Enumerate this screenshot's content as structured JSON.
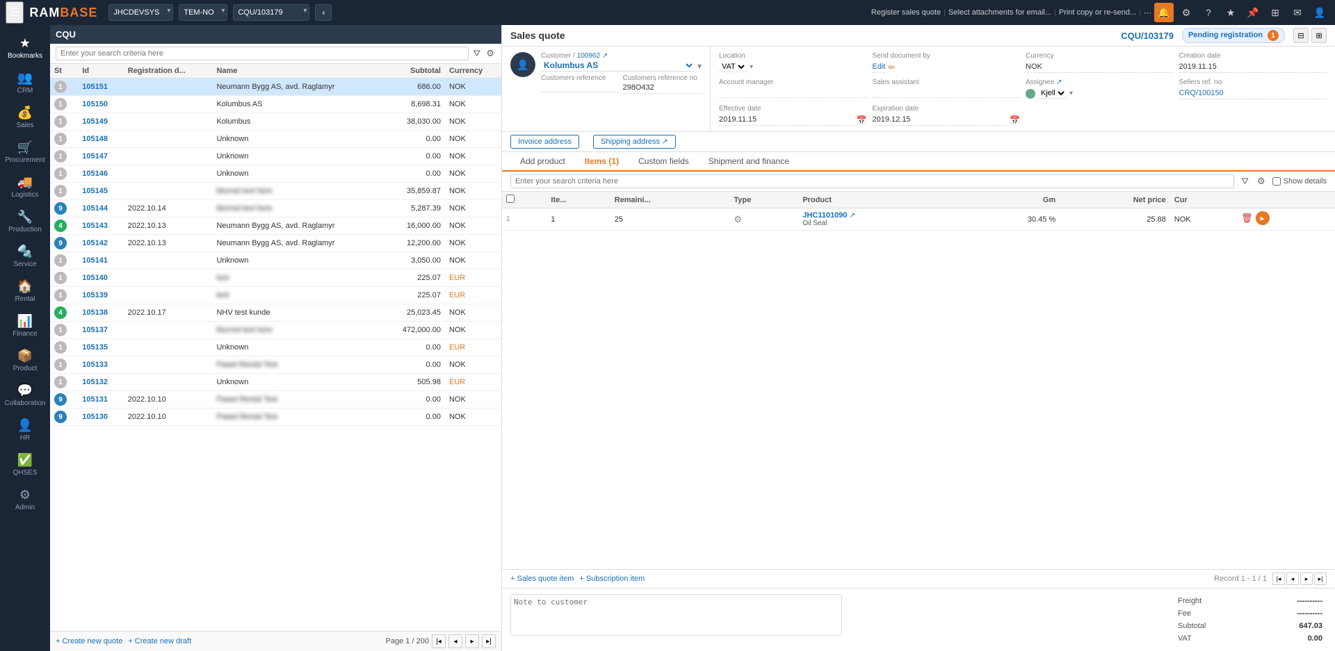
{
  "app": {
    "title": "RAMBASE",
    "module": "CQU"
  },
  "topbar": {
    "menu_icon": "☰",
    "logo": "RAMBASE",
    "dropdowns": [
      "JHCDEVSYS",
      "TEM-NO",
      "CQU/103179"
    ],
    "nav_back": "‹",
    "alert_icon": "🔔",
    "settings_icon": "⚙",
    "help_icon": "?",
    "star_icon": "★",
    "pin_icon": "📌",
    "menu_icon2": "☰",
    "email_icon": "✉",
    "user_icon": "👤",
    "actions": [
      "Register sales quote",
      "Select attachments for email...",
      "Print copy or re-send..."
    ],
    "more_icon": "⋯"
  },
  "sidebar": {
    "items": [
      {
        "id": "bookmarks",
        "label": "Bookmarks",
        "icon": "★"
      },
      {
        "id": "crm",
        "label": "CRM",
        "icon": "👥"
      },
      {
        "id": "sales",
        "label": "Sales",
        "icon": "💰"
      },
      {
        "id": "procurement",
        "label": "Procurement",
        "icon": "🛒"
      },
      {
        "id": "logistics",
        "label": "Logistics",
        "icon": "🚚"
      },
      {
        "id": "production",
        "label": "Production",
        "icon": "🔧"
      },
      {
        "id": "service",
        "label": "Service",
        "icon": "🔩"
      },
      {
        "id": "rental",
        "label": "Rental",
        "icon": "🏠"
      },
      {
        "id": "finance",
        "label": "Finance",
        "icon": "📊"
      },
      {
        "id": "product",
        "label": "Product",
        "icon": "📦"
      },
      {
        "id": "collaboration",
        "label": "Collaboration",
        "icon": "💬"
      },
      {
        "id": "hr",
        "label": "HR",
        "icon": "👤"
      },
      {
        "id": "qhses",
        "label": "QHSES",
        "icon": "✅"
      },
      {
        "id": "admin",
        "label": "Admin",
        "icon": "⚙"
      }
    ]
  },
  "left_panel": {
    "header": "CQU",
    "search_placeholder": "Enter your search criteria here",
    "columns": [
      "St",
      "Id",
      "Registration d...",
      "Name",
      "Subtotal",
      "Currency"
    ],
    "rows": [
      {
        "st": "1",
        "st_class": "status-1",
        "id": "105151",
        "reg_date": "",
        "name": "Neumann Bygg AS, avd. Raglamyr",
        "subtotal": "686.00",
        "currency": "NOK",
        "selected": true,
        "name_blurred": false
      },
      {
        "st": "1",
        "st_class": "status-1",
        "id": "105150",
        "reg_date": "",
        "name": "Kolumbus AS",
        "subtotal": "8,698.31",
        "currency": "NOK",
        "selected": false,
        "name_blurred": false
      },
      {
        "st": "1",
        "st_class": "status-1",
        "id": "105149",
        "reg_date": "",
        "name": "Kolumbus",
        "subtotal": "38,030.00",
        "currency": "NOK",
        "selected": false,
        "name_blurred": false
      },
      {
        "st": "1",
        "st_class": "status-1",
        "id": "105148",
        "reg_date": "",
        "name": "Unknown",
        "subtotal": "0.00",
        "currency": "NOK",
        "selected": false,
        "name_blurred": false
      },
      {
        "st": "1",
        "st_class": "status-1",
        "id": "105147",
        "reg_date": "",
        "name": "Unknown",
        "subtotal": "0.00",
        "currency": "NOK",
        "selected": false,
        "name_blurred": false
      },
      {
        "st": "1",
        "st_class": "status-1",
        "id": "105146",
        "reg_date": "",
        "name": "Unknown",
        "subtotal": "0.00",
        "currency": "NOK",
        "selected": false,
        "name_blurred": false
      },
      {
        "st": "1",
        "st_class": "status-1",
        "id": "105145",
        "reg_date": "",
        "name": "",
        "subtotal": "35,859.87",
        "currency": "NOK",
        "selected": false,
        "name_blurred": true
      },
      {
        "st": "9",
        "st_class": "status-9",
        "id": "105144",
        "reg_date": "2022.10.14",
        "name": "",
        "subtotal": "5,287.39",
        "currency": "NOK",
        "selected": false,
        "name_blurred": true
      },
      {
        "st": "4",
        "st_class": "status-4",
        "id": "105143",
        "reg_date": "2022.10.13",
        "name": "Neumann Bygg AS, avd. Raglamyr",
        "subtotal": "16,000.00",
        "currency": "NOK",
        "selected": false,
        "name_blurred": false
      },
      {
        "st": "9",
        "st_class": "status-9",
        "id": "105142",
        "reg_date": "2022.10.13",
        "name": "Neumann Bygg AS, avd. Raglamyr",
        "subtotal": "12,200.00",
        "currency": "NOK",
        "selected": false,
        "name_blurred": false
      },
      {
        "st": "1",
        "st_class": "status-1",
        "id": "105141",
        "reg_date": "",
        "name": "Unknown",
        "subtotal": "3,050.00",
        "currency": "NOK",
        "selected": false,
        "name_blurred": false
      },
      {
        "st": "1",
        "st_class": "status-1",
        "id": "105140",
        "reg_date": "",
        "name": "test",
        "subtotal": "225.07",
        "currency": "EUR",
        "selected": false,
        "name_blurred": true
      },
      {
        "st": "1",
        "st_class": "status-1",
        "id": "105139",
        "reg_date": "",
        "name": "test",
        "subtotal": "225.07",
        "currency": "EUR",
        "selected": false,
        "name_blurred": true
      },
      {
        "st": "4",
        "st_class": "status-4",
        "id": "105138",
        "reg_date": "2022.10.17",
        "name": "NHV test kunde",
        "subtotal": "25,023.45",
        "currency": "NOK",
        "selected": false,
        "name_blurred": false
      },
      {
        "st": "1",
        "st_class": "status-1",
        "id": "105137",
        "reg_date": "",
        "name": "",
        "subtotal": "472,000.00",
        "currency": "NOK",
        "selected": false,
        "name_blurred": true
      },
      {
        "st": "1",
        "st_class": "status-1",
        "id": "105135",
        "reg_date": "",
        "name": "Unknown",
        "subtotal": "0.00",
        "currency": "EUR",
        "selected": false,
        "name_blurred": false
      },
      {
        "st": "1",
        "st_class": "status-1",
        "id": "105133",
        "reg_date": "",
        "name": "Pawel Rental Test",
        "subtotal": "0.00",
        "currency": "NOK",
        "selected": false,
        "name_blurred": true
      },
      {
        "st": "1",
        "st_class": "status-1",
        "id": "105132",
        "reg_date": "",
        "name": "Unknown",
        "subtotal": "505.98",
        "currency": "EUR",
        "selected": false,
        "name_blurred": false
      },
      {
        "st": "9",
        "st_class": "status-9",
        "id": "105131",
        "reg_date": "2022.10.10",
        "name": "Pawel Rental Test",
        "subtotal": "0.00",
        "currency": "NOK",
        "selected": false,
        "name_blurred": true
      },
      {
        "st": "9",
        "st_class": "status-9",
        "id": "105130",
        "reg_date": "2022.10.10",
        "name": "Pawel Rental Test",
        "subtotal": "0.00",
        "currency": "NOK",
        "selected": false,
        "name_blurred": true
      }
    ],
    "footer": {
      "create_new_quote": "+ Create new quote",
      "create_new_draft": "+ Create new draft",
      "page_info": "Page 1 / 200"
    }
  },
  "right_panel": {
    "title": "Sales quote",
    "doc_id": "CQU/103179",
    "status": "Pending registration",
    "status_count": "1",
    "top_actions": [
      "Register sales quote",
      "Select attachments for email...",
      "Print copy or re-send..."
    ],
    "customer": {
      "number": "100962",
      "name": "Kolumbus AS",
      "ref_label": "Customers reference",
      "ref_value": "",
      "ref_no_label": "Customers reference no",
      "ref_no_value": "298O432"
    },
    "fields": {
      "location_label": "Location",
      "location_value": "VAT",
      "send_doc_label": "Send document by",
      "send_doc_action": "Edit",
      "currency_label": "Currency",
      "currency_value": "NOK",
      "creation_date_label": "Creation date",
      "creation_date_value": "2019.11.15",
      "account_manager_label": "Account manager",
      "account_manager_value": "",
      "sales_assistant_label": "Sales assistant",
      "sales_assistant_value": "",
      "assignee_label": "Assignee",
      "assignee_value": "Kjell",
      "sellers_ref_label": "Sellers ref. no",
      "sellers_ref_value": "CRQ/100150",
      "effective_date_label": "Effective date",
      "effective_date_value": "2019.11.15",
      "expiration_date_label": "Expiration date",
      "expiration_date_value": "2019.12.15"
    },
    "address": {
      "invoice_label": "Invoice address",
      "shipping_label": "Shipping address"
    },
    "tabs": [
      {
        "id": "add-product",
        "label": "Add product"
      },
      {
        "id": "items",
        "label": "Items (1)",
        "active": true
      },
      {
        "id": "custom-fields",
        "label": "Custom fields"
      },
      {
        "id": "shipment-finance",
        "label": "Shipment and finance"
      }
    ],
    "items_toolbar": {
      "search_placeholder": "Enter your search criteria here",
      "show_details": "Show details"
    },
    "items_columns": [
      "",
      "Ite...",
      "Remaini...",
      "Type",
      "Product",
      "Gm",
      "Net price",
      "Cur",
      ""
    ],
    "items": [
      {
        "row_num": "1",
        "item_no": "1",
        "remaining": "25",
        "type_icon": "⚙",
        "product_code": "JHC1101090",
        "product_name": "Oil Seal",
        "gm": "30.45 %",
        "net_price": "25.88",
        "currency": "NOK"
      }
    ],
    "footer": {
      "add_quote_item": "+ Sales quote item",
      "add_subscription": "+ Subscription item",
      "record_info": "Record 1 - 1 / 1"
    },
    "summary": {
      "note_placeholder": "Note to customer",
      "freight_label": "Freight",
      "freight_value": "----------",
      "fee_label": "Fee",
      "fee_value": "----------",
      "subtotal_label": "Subtotal",
      "subtotal_value": "647.03",
      "vat_label": "VAT",
      "vat_value": "0.00"
    }
  }
}
